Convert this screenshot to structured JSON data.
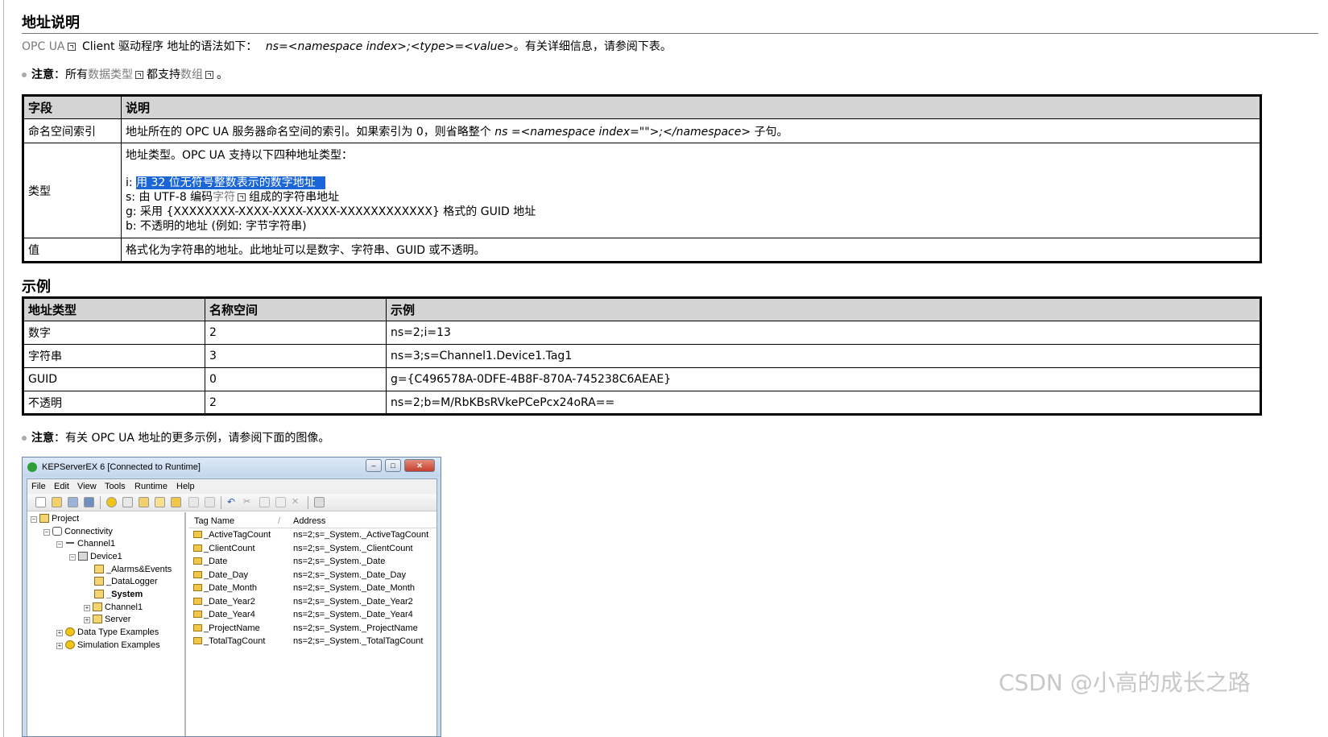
{
  "section1": {
    "heading": "地址说明",
    "intro": {
      "link1": "OPC UA",
      "text1": "Client 驱动程序 地址的语法如下：",
      "syntax": "ns=<namespace index>;<type>=<value>",
      "text2": "。有关详细信息，请参阅下表。"
    },
    "note1": {
      "label": "注意",
      "text1": "：所有",
      "link1": "数据类型",
      "text2": "都支持",
      "link2": "数组",
      "text3": "。"
    },
    "table": {
      "headers": [
        "字段",
        "说明"
      ],
      "rows": [
        {
          "field": "命名空间索引",
          "desc_pre": "地址所在的 OPC UA 服务器命名空间的索引。如果索引为 0，则省略整个 ",
          "desc_italic": "ns =<namespace index=\"\">;</namespace>",
          "desc_post": " 子句。"
        },
        {
          "field": "类型",
          "desc_intro": "地址类型。OPC UA 支持以下四种地址类型：",
          "i_prefix": "i: ",
          "i_text": "用 32 位无符号整数表示的数字地址",
          "s_prefix": "s: 由 UTF-8 编码",
          "s_link": "字符",
          "s_post": "组成的字符串地址",
          "g_line": "g: 采用 {XXXXXXXX-XXXX-XXXX-XXXX-XXXXXXXXXXXX} 格式的 GUID 地址",
          "b_line": "b: 不透明的地址 (例如: 字节字符串)"
        },
        {
          "field": "值",
          "desc": "格式化为字符串的地址。此地址可以是数字、字符串、GUID 或不透明。"
        }
      ]
    }
  },
  "section2": {
    "heading": "示例",
    "table": {
      "headers": [
        "地址类型",
        "名称空间",
        "示例"
      ],
      "rows": [
        [
          "数字",
          "2",
          "ns=2;i=13"
        ],
        [
          "字符串",
          "3",
          "ns=3;s=Channel1.Device1.Tag1"
        ],
        [
          "GUID",
          "0",
          "g={C496578A-0DFE-4B8F-870A-745238C6AEAE}"
        ],
        [
          "不透明",
          "2",
          "ns=2;b=M/RbKBsRVkePCePcx24oRA=="
        ]
      ]
    },
    "note2": {
      "label": "注意",
      "text": "：有关 OPC UA 地址的更多示例，请参阅下面的图像。"
    }
  },
  "screenshot": {
    "title": "KEPServerEX 6  [Connected to Runtime]",
    "menu": [
      "File",
      "Edit",
      "View",
      "Tools",
      "Runtime",
      "Help"
    ],
    "tree": [
      {
        "label": "Project",
        "level": 0
      },
      {
        "label": "Connectivity",
        "level": 1
      },
      {
        "label": "Channel1",
        "level": 2
      },
      {
        "label": "Device1",
        "level": 3
      },
      {
        "label": "_Alarms&Events",
        "level": 4
      },
      {
        "label": "_DataLogger",
        "level": 4
      },
      {
        "label": "_System",
        "level": 4
      },
      {
        "label": "Channel1",
        "level": 4
      },
      {
        "label": "Server",
        "level": 4
      },
      {
        "label": "Data Type Examples",
        "level": 2
      },
      {
        "label": "Simulation Examples",
        "level": 2
      }
    ],
    "columns": [
      "Tag Name",
      "Address"
    ],
    "tags": [
      {
        "name": "_ActiveTagCount",
        "address": "ns=2;s=_System._ActiveTagCount"
      },
      {
        "name": "_ClientCount",
        "address": "ns=2;s=_System._ClientCount"
      },
      {
        "name": "_Date",
        "address": "ns=2;s=_System._Date"
      },
      {
        "name": "_Date_Day",
        "address": "ns=2;s=_System._Date_Day"
      },
      {
        "name": "_Date_Month",
        "address": "ns=2;s=_System._Date_Month"
      },
      {
        "name": "_Date_Year2",
        "address": "ns=2;s=_System._Date_Year2"
      },
      {
        "name": "_Date_Year4",
        "address": "ns=2;s=_System._Date_Year4"
      },
      {
        "name": "_ProjectName",
        "address": "ns=2;s=_System._ProjectName"
      },
      {
        "name": "_TotalTagCount",
        "address": "ns=2;s=_System._TotalTagCount"
      }
    ]
  },
  "watermark": "CSDN @小高的成长之路"
}
